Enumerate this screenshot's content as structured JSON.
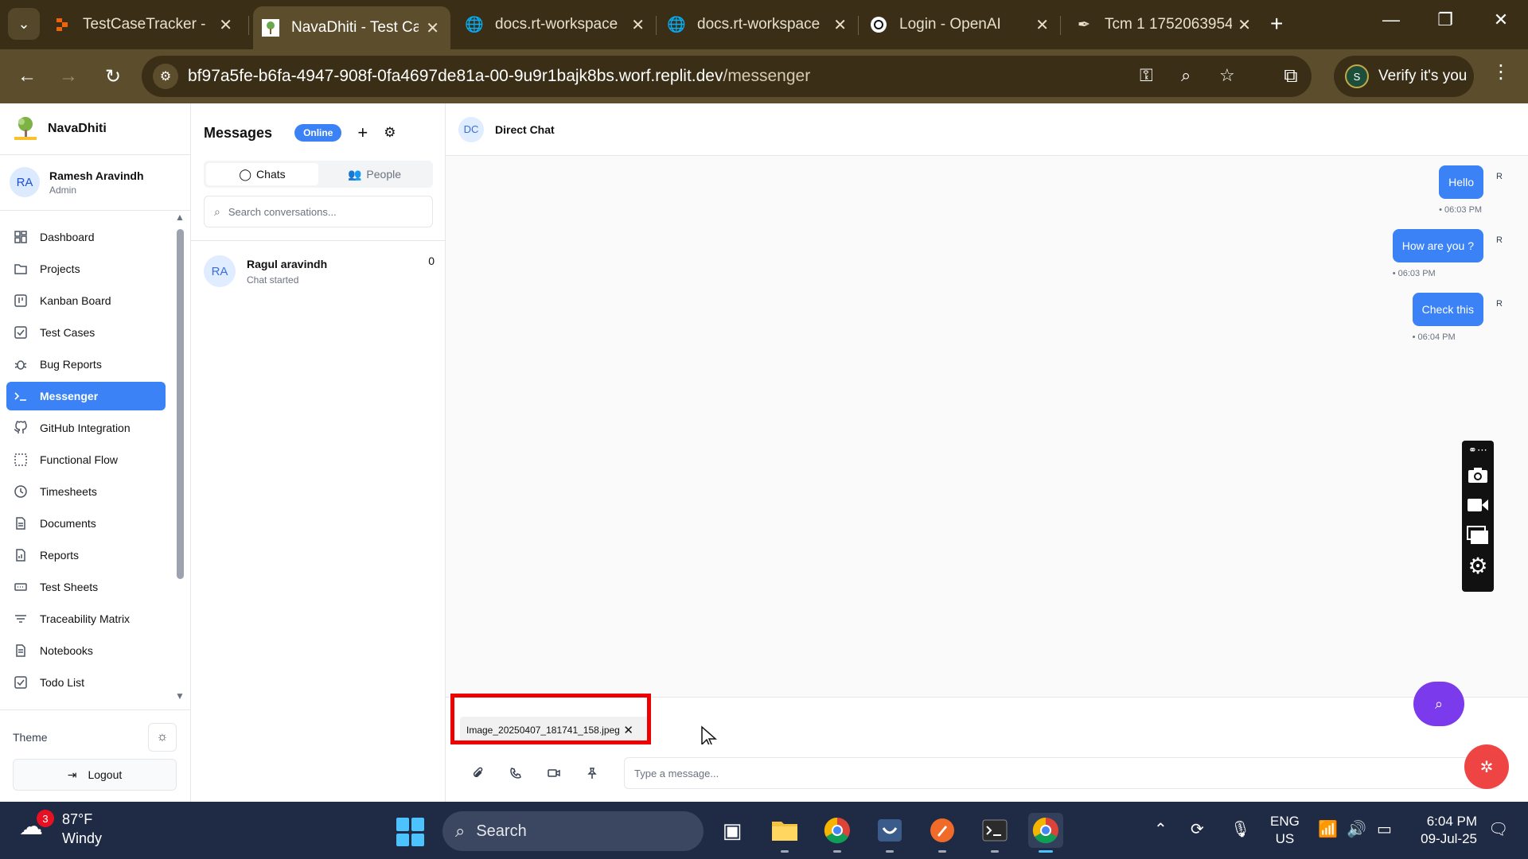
{
  "browser": {
    "tabs": [
      {
        "title": "TestCaseTracker - R",
        "icon": "replit-icon",
        "active": false
      },
      {
        "title": "NavaDhiti - Test Ca",
        "icon": "navadhiti-favicon",
        "active": true
      },
      {
        "title": "docs.rt-workspace",
        "icon": "globe-icon",
        "active": false
      },
      {
        "title": "docs.rt-workspace",
        "icon": "globe-icon",
        "active": false
      },
      {
        "title": "Login - OpenAI",
        "icon": "openai-icon",
        "active": false
      },
      {
        "title": "Tcm 1 1752063954",
        "icon": "feather-icon",
        "active": false
      }
    ],
    "url_host": "bf97a5fe-b6fa-4947-908f-0fa4697de81a-00-9u9r1bajk8bs.worf.replit.dev",
    "url_path": "/messenger",
    "profile_initial": "S",
    "profile_label": "Verify it's you"
  },
  "app": {
    "brand": "NavaDhiti",
    "user": {
      "initials": "RA",
      "name": "Ramesh Aravindh",
      "role": "Admin"
    },
    "nav": [
      {
        "label": "Dashboard",
        "icon": "dashboard-icon",
        "active": false
      },
      {
        "label": "Projects",
        "icon": "projects-icon",
        "active": false
      },
      {
        "label": "Kanban Board",
        "icon": "kanban-icon",
        "active": false
      },
      {
        "label": "Test Cases",
        "icon": "checkbox-icon",
        "active": false
      },
      {
        "label": "Bug Reports",
        "icon": "bug-icon",
        "active": false
      },
      {
        "label": "Messenger",
        "icon": "terminal-icon",
        "active": true
      },
      {
        "label": "GitHub Integration",
        "icon": "github-icon",
        "active": false
      },
      {
        "label": "Functional Flow",
        "icon": "flow-icon",
        "active": false
      },
      {
        "label": "Timesheets",
        "icon": "clock-icon",
        "active": false
      },
      {
        "label": "Documents",
        "icon": "document-icon",
        "active": false
      },
      {
        "label": "Reports",
        "icon": "report-icon",
        "active": false
      },
      {
        "label": "Test Sheets",
        "icon": "sheet-icon",
        "active": false
      },
      {
        "label": "Traceability Matrix",
        "icon": "filter-icon",
        "active": false
      },
      {
        "label": "Notebooks",
        "icon": "notebook-icon",
        "active": false
      },
      {
        "label": "Todo List",
        "icon": "todo-icon",
        "active": false
      }
    ],
    "theme_label": "Theme",
    "logout_label": "Logout"
  },
  "messages": {
    "title": "Messages",
    "status": "Online",
    "tabs": [
      "Chats",
      "People"
    ],
    "search_placeholder": "Search conversations...",
    "conversations": [
      {
        "initials": "RA",
        "name": "Ragul aravindh",
        "subtitle": "Chat started",
        "count": "0"
      }
    ]
  },
  "chat": {
    "initials": "DC",
    "title": "Direct Chat",
    "messages": [
      {
        "text": "Hello",
        "sender": "R",
        "time": "• 06:03 PM"
      },
      {
        "text": "How are you ?",
        "sender": "R",
        "time": "• 06:03 PM"
      },
      {
        "text": "Check this",
        "sender": "R",
        "time": "• 06:04 PM"
      }
    ],
    "attachment_name": "Image_20250407_181741_158.jpeg",
    "input_placeholder": "Type a message..."
  },
  "taskbar": {
    "weather_temp": "87°F",
    "weather_desc": "Windy",
    "weather_badge": "3",
    "search_label": "Search",
    "lang_line1": "ENG",
    "lang_line2": "US",
    "time": "6:04 PM",
    "date": "09-Jul-25"
  }
}
